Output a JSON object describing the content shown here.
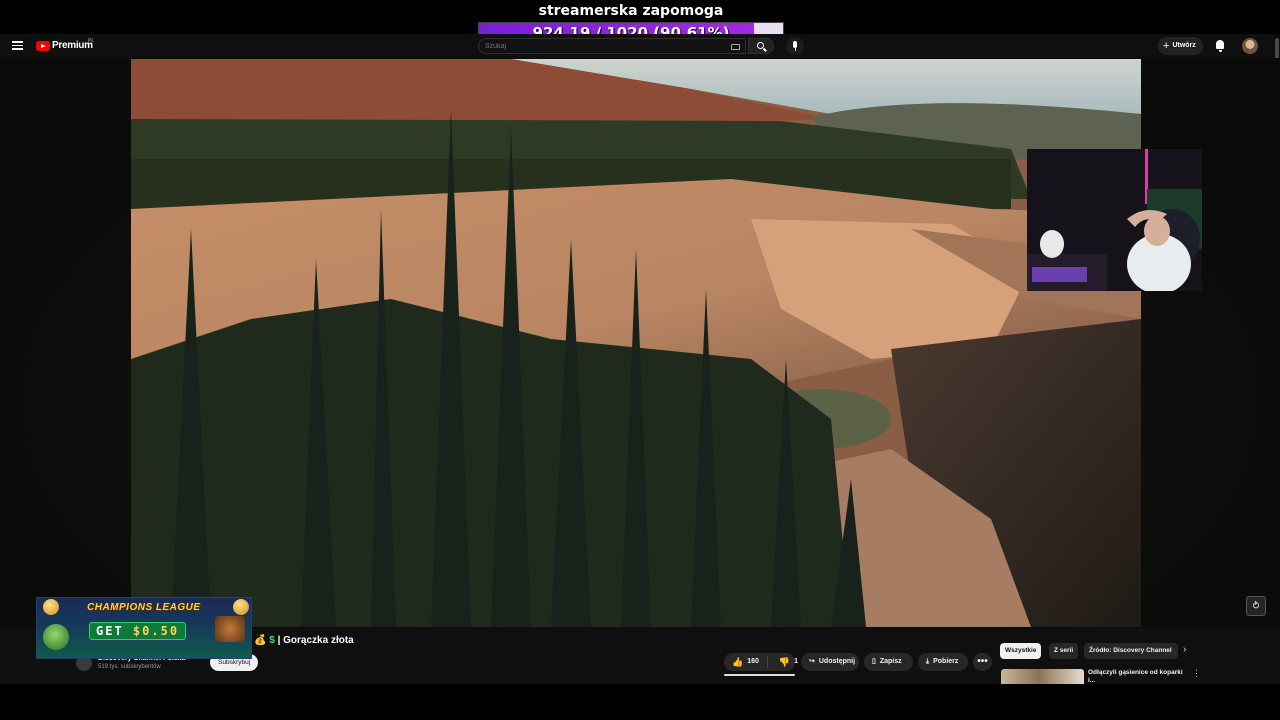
{
  "overlay": {
    "goal_title": "streamerska zapomoga",
    "goal_text": "924.19 / 1020 (90.61%)",
    "goal_progress": 0.9061
  },
  "header": {
    "brand": "Premium",
    "country": "PL",
    "search_placeholder": "Szukaj",
    "create_label": "Utwórz"
  },
  "video": {
    "title": "| Gorączka złota",
    "title_emoji_bag": "💰",
    "title_emoji_dollar": "$",
    "channel_name": "Discovery Channel Polska",
    "subscribers": "519 tys. subskrybentów",
    "subscribe_label": "Subskrybuj"
  },
  "actions": {
    "likes": "160",
    "dislikes": "1",
    "share": "Udostępnij",
    "save": "Zapisz",
    "download": "Pobierz",
    "more": "•••"
  },
  "chips": {
    "all": "Wszystkie",
    "series": "Z serii",
    "source": "Źródło: Discovery Channel"
  },
  "recommendation": {
    "title": "Odłączyli gąsienice od koparki i..."
  },
  "ad": {
    "title": "CHAMPIONS LEAGUE",
    "get_label": "GET",
    "amount": "$0.50"
  },
  "colors": {
    "goal_fill": "#7a1fd6",
    "youtube_red": "#ff0000",
    "background": "#0f0f0f"
  }
}
